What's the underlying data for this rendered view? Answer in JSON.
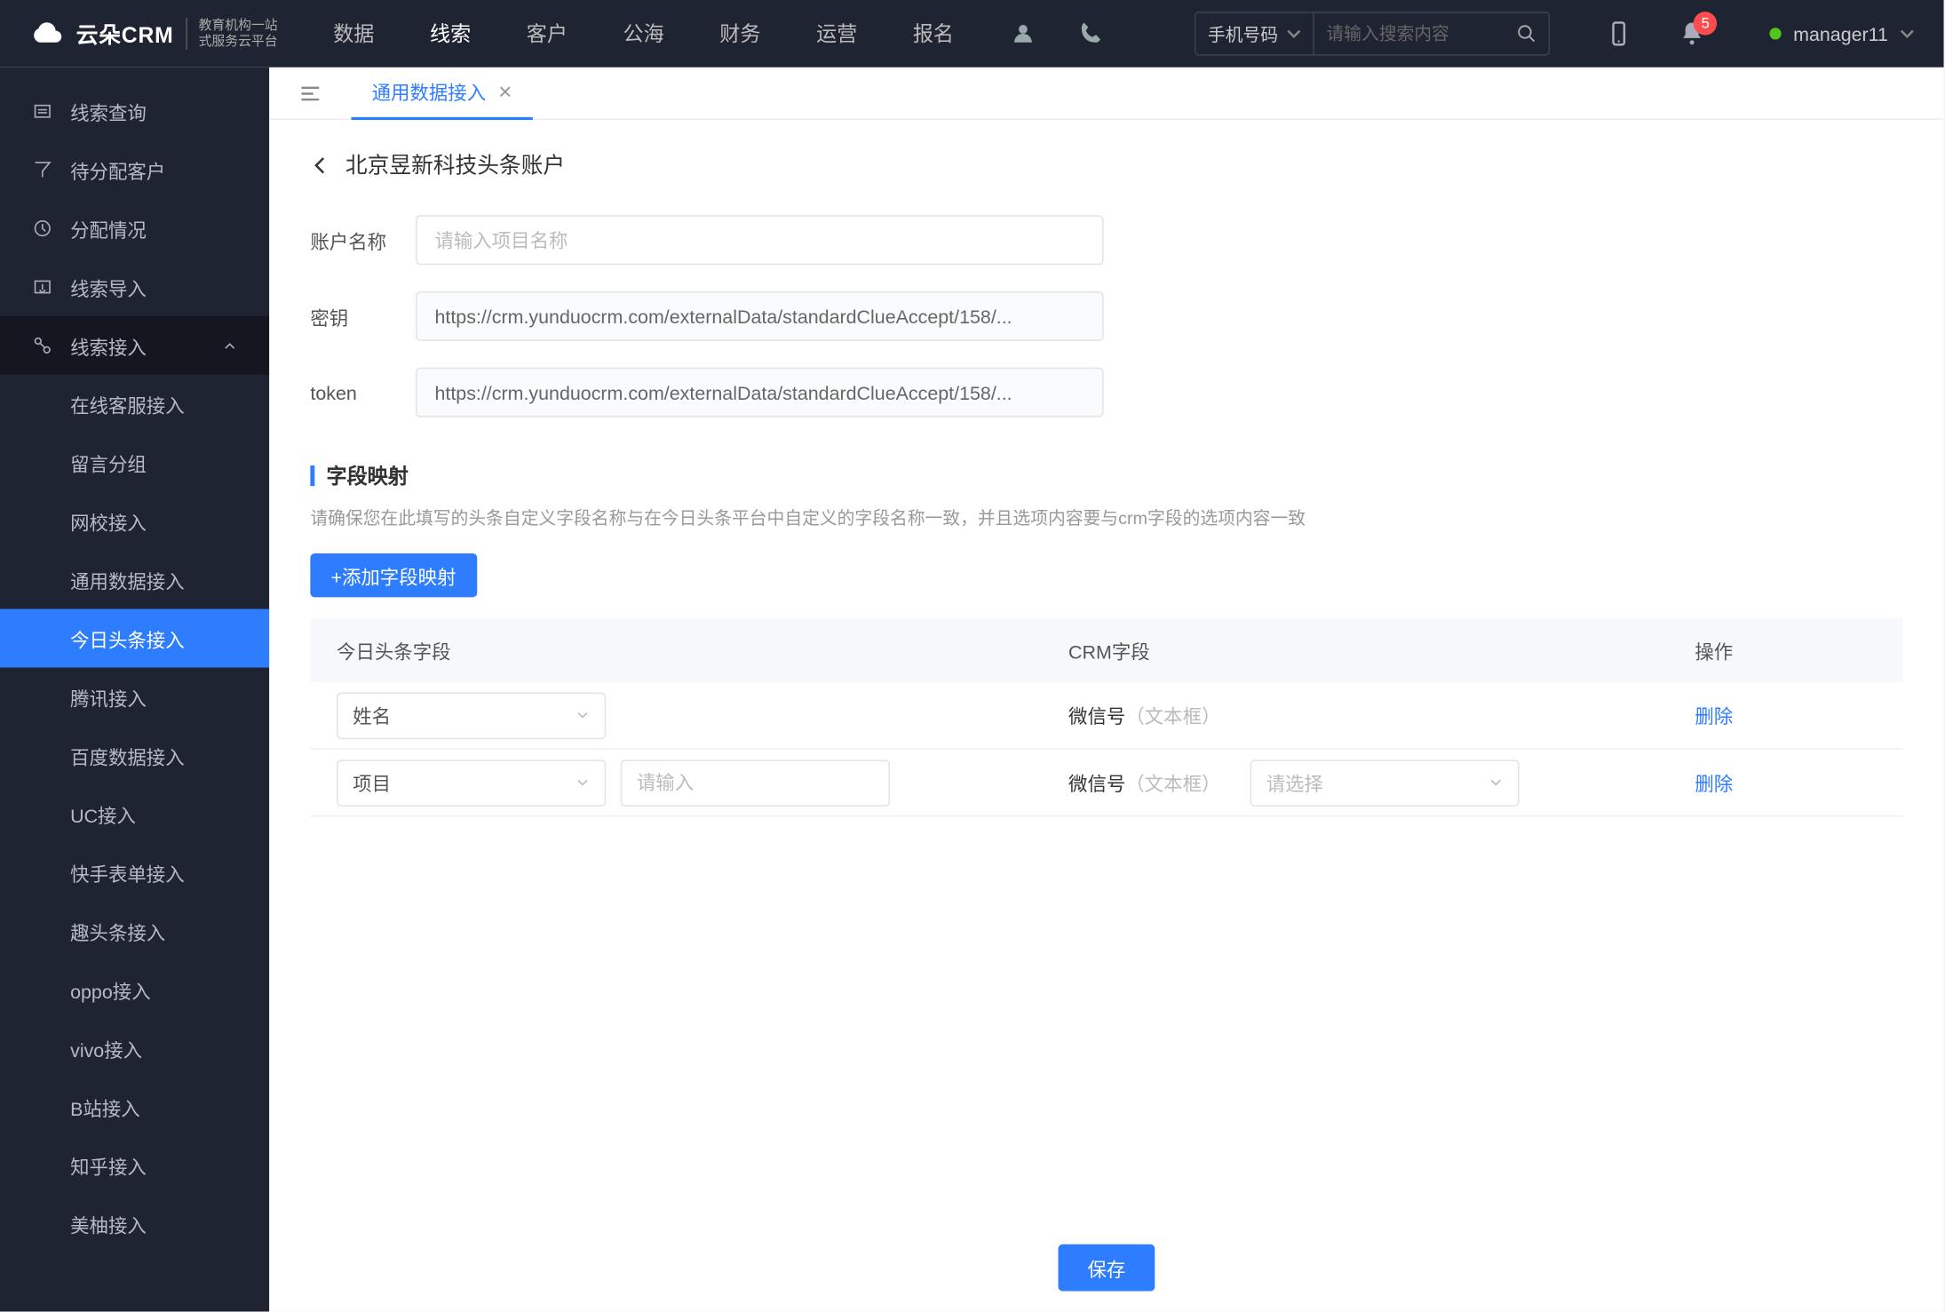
{
  "logo": {
    "brand": "云朵CRM",
    "sub1": "教育机构一站",
    "sub2": "式服务云平台"
  },
  "nav": [
    "数据",
    "线索",
    "客户",
    "公海",
    "财务",
    "运营",
    "报名"
  ],
  "nav_active_index": 1,
  "search": {
    "type": "手机号码",
    "placeholder": "请输入搜索内容"
  },
  "badge_count": "5",
  "username": "manager11",
  "sidebar": {
    "top": [
      {
        "label": "线索查询"
      },
      {
        "label": "待分配客户"
      },
      {
        "label": "分配情况"
      },
      {
        "label": "线索导入"
      }
    ],
    "expand_label": "线索接入",
    "subs": [
      "在线客服接入",
      "留言分组",
      "网校接入",
      "通用数据接入",
      "今日头条接入",
      "腾讯接入",
      "百度数据接入",
      "UC接入",
      "快手表单接入",
      "趣头条接入",
      "oppo接入",
      "vivo接入",
      "B站接入",
      "知乎接入",
      "美柚接入"
    ],
    "active_sub_index": 4
  },
  "tab": {
    "label": "通用数据接入"
  },
  "breadcrumb": "北京昱新科技头条账户",
  "form": {
    "name_label": "账户名称",
    "name_placeholder": "请输入项目名称",
    "secret_label": "密钥",
    "secret_value": "https://crm.yunduocrm.com/externalData/standardClueAccept/158/...",
    "token_label": "token",
    "token_value": "https://crm.yunduocrm.com/externalData/standardClueAccept/158/..."
  },
  "section": {
    "title": "字段映射",
    "help": "请确保您在此填写的头条自定义字段名称与在今日头条平台中自定义的字段名称一致，并且选项内容要与crm字段的选项内容一致",
    "add_button": "+添加字段映射"
  },
  "table": {
    "headers": [
      "今日头条字段",
      "CRM字段",
      "操作"
    ],
    "rows": [
      {
        "field": "姓名",
        "extra_input": false,
        "crm": "微信号",
        "crm_type": "（文本框）",
        "crm_select": false,
        "action": "删除"
      },
      {
        "field": "项目",
        "extra_input": true,
        "extra_placeholder": "请输入",
        "crm": "微信号",
        "crm_type": "（文本框）",
        "crm_select": true,
        "crm_select_placeholder": "请选择",
        "action": "删除"
      }
    ]
  },
  "save_button": "保存"
}
